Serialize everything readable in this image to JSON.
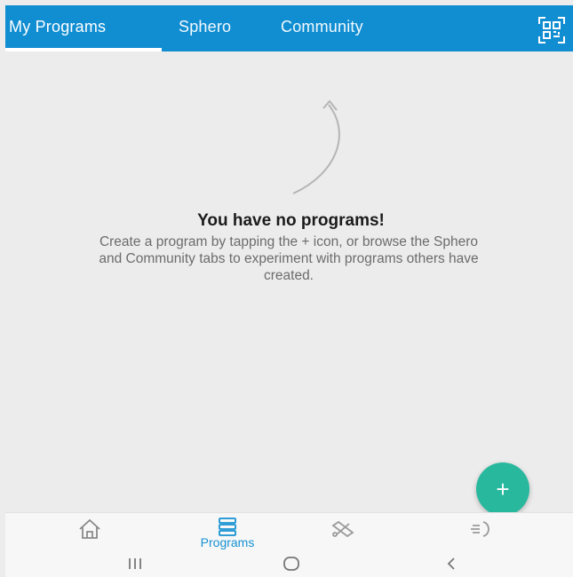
{
  "header": {
    "tabs": [
      {
        "label": "My Programs",
        "active": true
      },
      {
        "label": "Sphero",
        "active": false
      },
      {
        "label": "Community",
        "active": false
      }
    ],
    "qr_icon": "qr-code-icon"
  },
  "empty_state": {
    "title": "You have no programs!",
    "description": "Create a program by tapping the + icon, or browse the Sphero and Community tabs to experiment with programs others have created."
  },
  "fab": {
    "label": "+"
  },
  "bottom_nav": {
    "items": [
      {
        "icon": "home-icon",
        "label": ""
      },
      {
        "icon": "programs-icon",
        "label": "Programs",
        "active": true
      },
      {
        "icon": "drive-icon",
        "label": ""
      },
      {
        "icon": "sensors-icon",
        "label": ""
      }
    ]
  },
  "system_nav": {
    "recents": "III",
    "home": "home-pill-icon",
    "back": "<"
  },
  "colors": {
    "header_bg": "#118ed2",
    "background": "#ececec",
    "fab": "#27b89e",
    "accent": "#1592d2"
  }
}
